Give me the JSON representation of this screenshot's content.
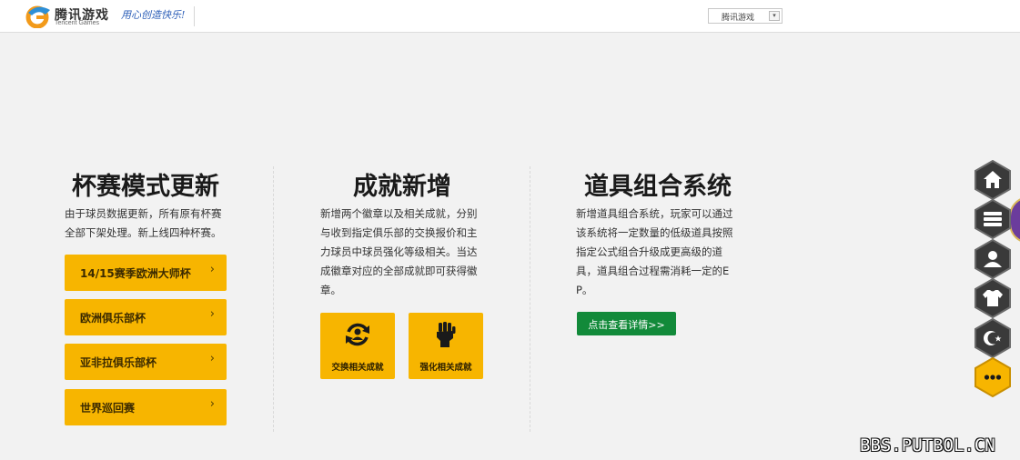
{
  "header": {
    "logo_cn": "腾讯游戏",
    "logo_en": "Tencent Games",
    "slogan": "用心创造快乐!",
    "game_select_value": "腾讯游戏"
  },
  "columns": {
    "cup": {
      "title": "杯赛模式更新",
      "desc_lines": [
        "由于球员数据更新，所有原有杯赛",
        "全部下架处理。新上线四种杯赛。"
      ],
      "buttons": [
        {
          "label": "14/15赛季欧洲大师杯"
        },
        {
          "label": "欧洲俱乐部杯"
        },
        {
          "label": "亚非拉俱乐部杯"
        },
        {
          "label": "世界巡回赛"
        }
      ],
      "arrow": "›"
    },
    "achievement": {
      "title": "成就新增",
      "desc_lines": [
        "新增两个徽章以及相关成就，分别",
        "与收到指定俱乐部的交换报价和主",
        "力球员中球员强化等级相关。当达",
        "成徽章对应的全部成就即可获得徽",
        "章。"
      ],
      "cards": [
        {
          "label": "交换相关成就",
          "icon": "exchange-icon"
        },
        {
          "label": "强化相关成就",
          "icon": "fist-icon"
        }
      ]
    },
    "items": {
      "title": "道具组合系统",
      "desc_lines": [
        "新增道具组合系统，玩家可以通过",
        "该系统将一定数量的低级道具按照",
        "指定公式组合升级成更高级的道",
        "具，道具组合过程需消耗一定的E",
        "P。"
      ],
      "detail_button": "点击查看详情>>"
    }
  },
  "sidenav": [
    "home-icon",
    "server-icon",
    "user-icon",
    "shirt-icon",
    "crescent-star-icon",
    "more-icon"
  ],
  "colors": {
    "accent": "#f7b500",
    "green": "#128a3a",
    "nav": "#3a3a3a"
  },
  "watermark": "BBS.PUTBOL.CN"
}
